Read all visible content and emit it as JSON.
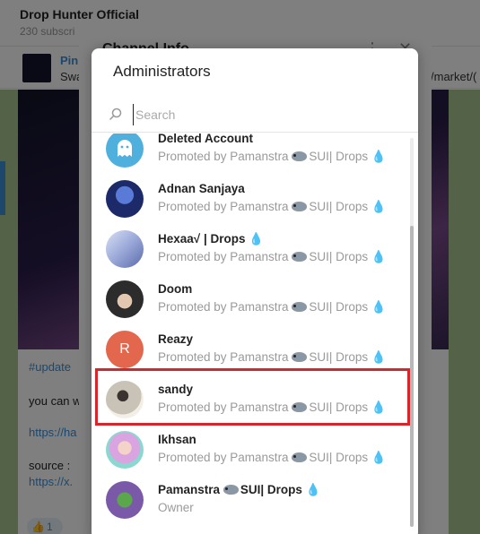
{
  "background": {
    "channel_title": "Drop Hunter Official",
    "channel_subtitle": "230 subscri",
    "pinned_title": "Pin",
    "pinned_text": "Swa",
    "pinned_url": "/market/(",
    "message": {
      "tag": "#update",
      "line1": "you can w",
      "link1": "https://ha",
      "line2": "source :",
      "link2": "https://x.",
      "reaction_count": "1"
    },
    "info_dialog_title": "Channel Info"
  },
  "dialog": {
    "title": "Administrators",
    "search_placeholder": "Search"
  },
  "admins": [
    {
      "name": "Deleted Account",
      "subtitle": "Promoted by Pamanstra",
      "sub_suffix": "SUI| Drops",
      "avatar": "ghost-icon",
      "avatar_color": "#4fb0de"
    },
    {
      "name": "Adnan Sanjaya",
      "subtitle": "Promoted by Pamanstra",
      "sub_suffix": "SUI| Drops",
      "avatar": "photo",
      "avatar_color": "#1d2a6a"
    },
    {
      "name": "Hexaa√ | Drops",
      "subtitle": "Promoted by Pamanstra",
      "sub_suffix": "SUI| Drops",
      "avatar": "photo",
      "avatar_color": "#9aa8d8"
    },
    {
      "name": "Doom",
      "subtitle": "Promoted by Pamanstra",
      "sub_suffix": "SUI| Drops",
      "avatar": "photo",
      "avatar_color": "#2c2c2c"
    },
    {
      "name": "Reazy",
      "subtitle": "Promoted by Pamanstra",
      "sub_suffix": "SUI| Drops",
      "avatar": "letter",
      "letter": "R",
      "avatar_color": "#e3674d"
    },
    {
      "name": "sandy",
      "subtitle": "Promoted by Pamanstra",
      "sub_suffix": "SUI| Drops",
      "avatar": "photo",
      "avatar_color": "#c9c2b6"
    },
    {
      "name": "Ikhsan",
      "subtitle": "Promoted by Pamanstra",
      "sub_suffix": "SUI| Drops",
      "avatar": "photo",
      "avatar_color": "#d9a4e0"
    },
    {
      "name": "Pamanstra",
      "name_suffix": "SUI| Drops",
      "subtitle": "Owner",
      "avatar": "photo",
      "avatar_color": "#7a5aa8"
    }
  ],
  "colors": {
    "accent": "#3a9be0",
    "highlight": "#d7262b"
  }
}
